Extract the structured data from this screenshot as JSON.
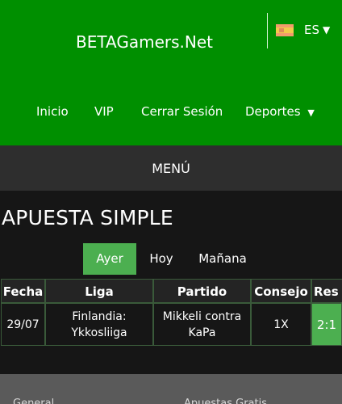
{
  "header": {
    "brand": "BETAGamers.Net",
    "language": {
      "code": "ES",
      "icon": "spain-flag-icon",
      "caret": "▼"
    }
  },
  "nav": {
    "items": [
      "Inicio",
      "VIP",
      "Cerrar Sesión",
      "Deportes"
    ],
    "dropdown_caret": "▼"
  },
  "menu_bar": {
    "label": "MENÚ"
  },
  "page_title": "APUESTA SIMPLE",
  "tabs": [
    {
      "label": "Ayer",
      "active": true
    },
    {
      "label": "Hoy",
      "active": false
    },
    {
      "label": "Mañana",
      "active": false
    }
  ],
  "table": {
    "headers": [
      "Fecha",
      "Liga",
      "Partido",
      "Consejo",
      "Res"
    ],
    "rows": [
      {
        "fecha": "29/07",
        "liga": "Finlandia: Ykkosliiga",
        "partido": "Mikkeli contra KaPa",
        "consejo": "1X",
        "res": "2:1"
      }
    ]
  },
  "footer": {
    "items": [
      "General",
      "Apuestas Gratis"
    ]
  },
  "colors": {
    "header_green": "#008f00",
    "accent_green": "#4caf50",
    "menu_bar": "#2e2e2e",
    "background": "#161616",
    "footer": "#5a5a5a"
  }
}
